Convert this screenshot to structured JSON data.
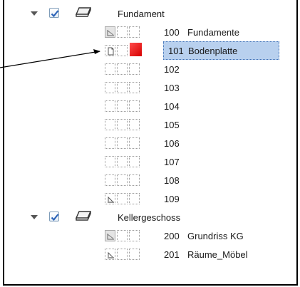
{
  "tree": {
    "groups": [
      {
        "label": "Fundament",
        "checked": true,
        "items": [
          {
            "num": "100",
            "label": "Fundamente"
          },
          {
            "num": "101",
            "label": "Bodenplatte"
          },
          {
            "num": "102",
            "label": ""
          },
          {
            "num": "103",
            "label": ""
          },
          {
            "num": "104",
            "label": ""
          },
          {
            "num": "105",
            "label": ""
          },
          {
            "num": "106",
            "label": ""
          },
          {
            "num": "107",
            "label": ""
          },
          {
            "num": "108",
            "label": ""
          },
          {
            "num": "109",
            "label": ""
          }
        ]
      },
      {
        "label": "Kellergeschoss",
        "checked": true,
        "items": [
          {
            "num": "200",
            "label": "Grundriss KG"
          },
          {
            "num": "201",
            "label": "Räume_Möbel"
          }
        ]
      }
    ]
  },
  "colors": {
    "selection": "#b8d0ee",
    "check": "#2b63b8",
    "red_marker": "#e00000"
  },
  "icons": [
    "chevron-down-icon",
    "checkbox-checked-icon",
    "layer-group-icon",
    "plan-view-icon",
    "section-icon",
    "page-icon",
    "red-marker-icon"
  ]
}
